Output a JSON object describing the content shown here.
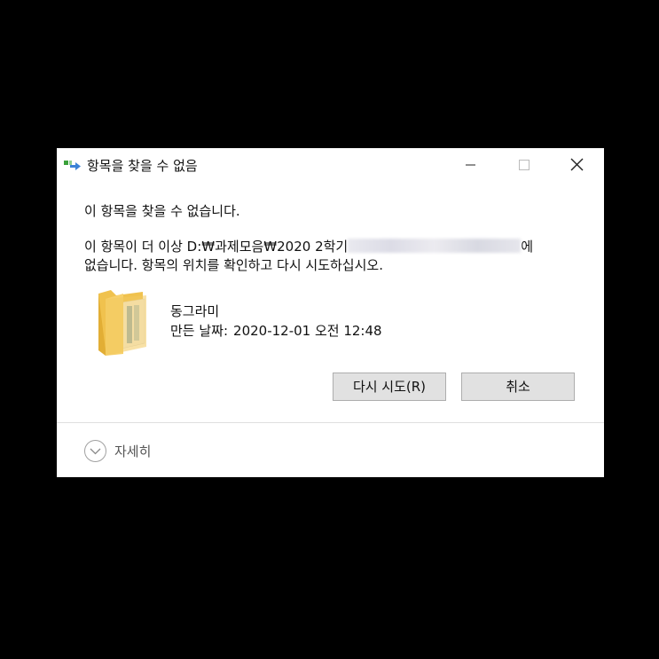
{
  "window": {
    "title": "항목을 찾을 수 없음",
    "icons": {
      "app": "file-move-icon",
      "minimize": "minimize-icon",
      "maximize": "maximize-icon",
      "close": "close-icon"
    }
  },
  "message": {
    "heading": "이 항목을 찾을 수 없습니다.",
    "line1_prefix": "이 항목이 더 이상 D:₩과제모음₩2020 2학기",
    "line1_suffix": "에",
    "line2": "없습니다. 항목의 위치를 확인하고 다시 시도하십시오."
  },
  "item": {
    "icon": "folder-icon",
    "name": "동그라미",
    "date_label": "만든 날짜:",
    "date_value": "2020-12-01 오전 12:48"
  },
  "buttons": {
    "retry": "다시 시도(R)",
    "cancel": "취소"
  },
  "details": {
    "label": "자세히",
    "icon": "chevron-down-circle-icon"
  },
  "colors": {
    "background": "#000000",
    "dialog": "#ffffff",
    "button_face": "#e1e1e1",
    "button_border": "#adadad",
    "folder": "#f3c95c"
  }
}
